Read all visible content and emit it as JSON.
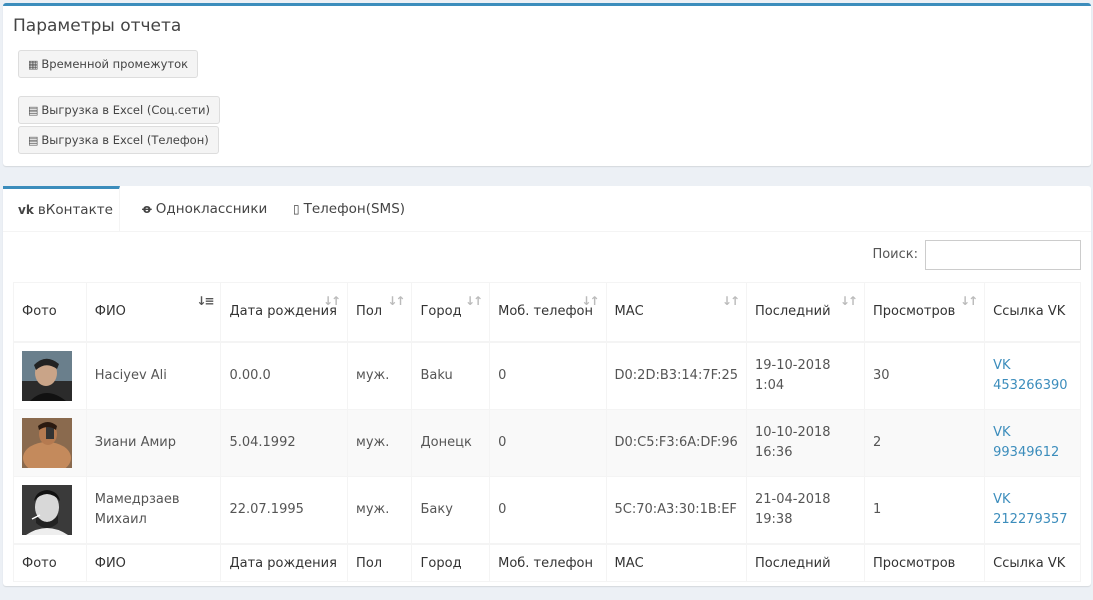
{
  "params": {
    "title": "Параметры отчета",
    "buttons": [
      {
        "icon": "calendar-icon",
        "label": "Временной промежуток"
      },
      {
        "icon": "excel-file-icon",
        "label": "Выгрузка в Excel (Соц.сети)"
      },
      {
        "icon": "excel-file-icon",
        "label": "Выгрузка в Excel (Телефон)"
      }
    ]
  },
  "tabs": [
    {
      "icon": "vk-icon",
      "label": "вКонтакте",
      "active": true
    },
    {
      "icon": "odnoklassniki-icon",
      "label": "Одноклассники",
      "active": false
    },
    {
      "icon": "mobile-phone-icon",
      "label": "Телефон(SMS)",
      "active": false
    }
  ],
  "search": {
    "label": "Поиск:",
    "value": ""
  },
  "table": {
    "header": {
      "photo": "Фото",
      "name": "ФИО",
      "birth": "Дата рождения",
      "gender": "Пол",
      "city": "Город",
      "phone": "Моб. телефон",
      "mac": "МАС",
      "last": "Последний",
      "views": "Просмотров",
      "link": "Ссылка VK"
    },
    "rows": [
      {
        "name": "Haciyev Ali",
        "birth": "0.00.0",
        "gender": "муж.",
        "city": "Baku",
        "phone": "0",
        "mac": "D0:2D:B3:14:7F:25",
        "last": "19-10-2018 1:04",
        "views": "30",
        "link": "VK 453266390"
      },
      {
        "name": "Зиани Амир",
        "birth": "5.04.1992",
        "gender": "муж.",
        "city": "Донецк",
        "phone": "0",
        "mac": "D0:C5:F3:6A:DF:96",
        "last": "10-10-2018 16:36",
        "views": "2",
        "link": "VK 99349612"
      },
      {
        "name": "Мамедрзаев Михаил",
        "birth": "22.07.1995",
        "gender": "муж.",
        "city": "Баку",
        "phone": "0",
        "mac": "5C:70:A3:30:1B:EF",
        "last": "21-04-2018 19:38",
        "views": "1",
        "link": "VK 212279357"
      }
    ]
  },
  "colors": {
    "accent": "#3c8dbc",
    "link": "#3c8dbc"
  }
}
